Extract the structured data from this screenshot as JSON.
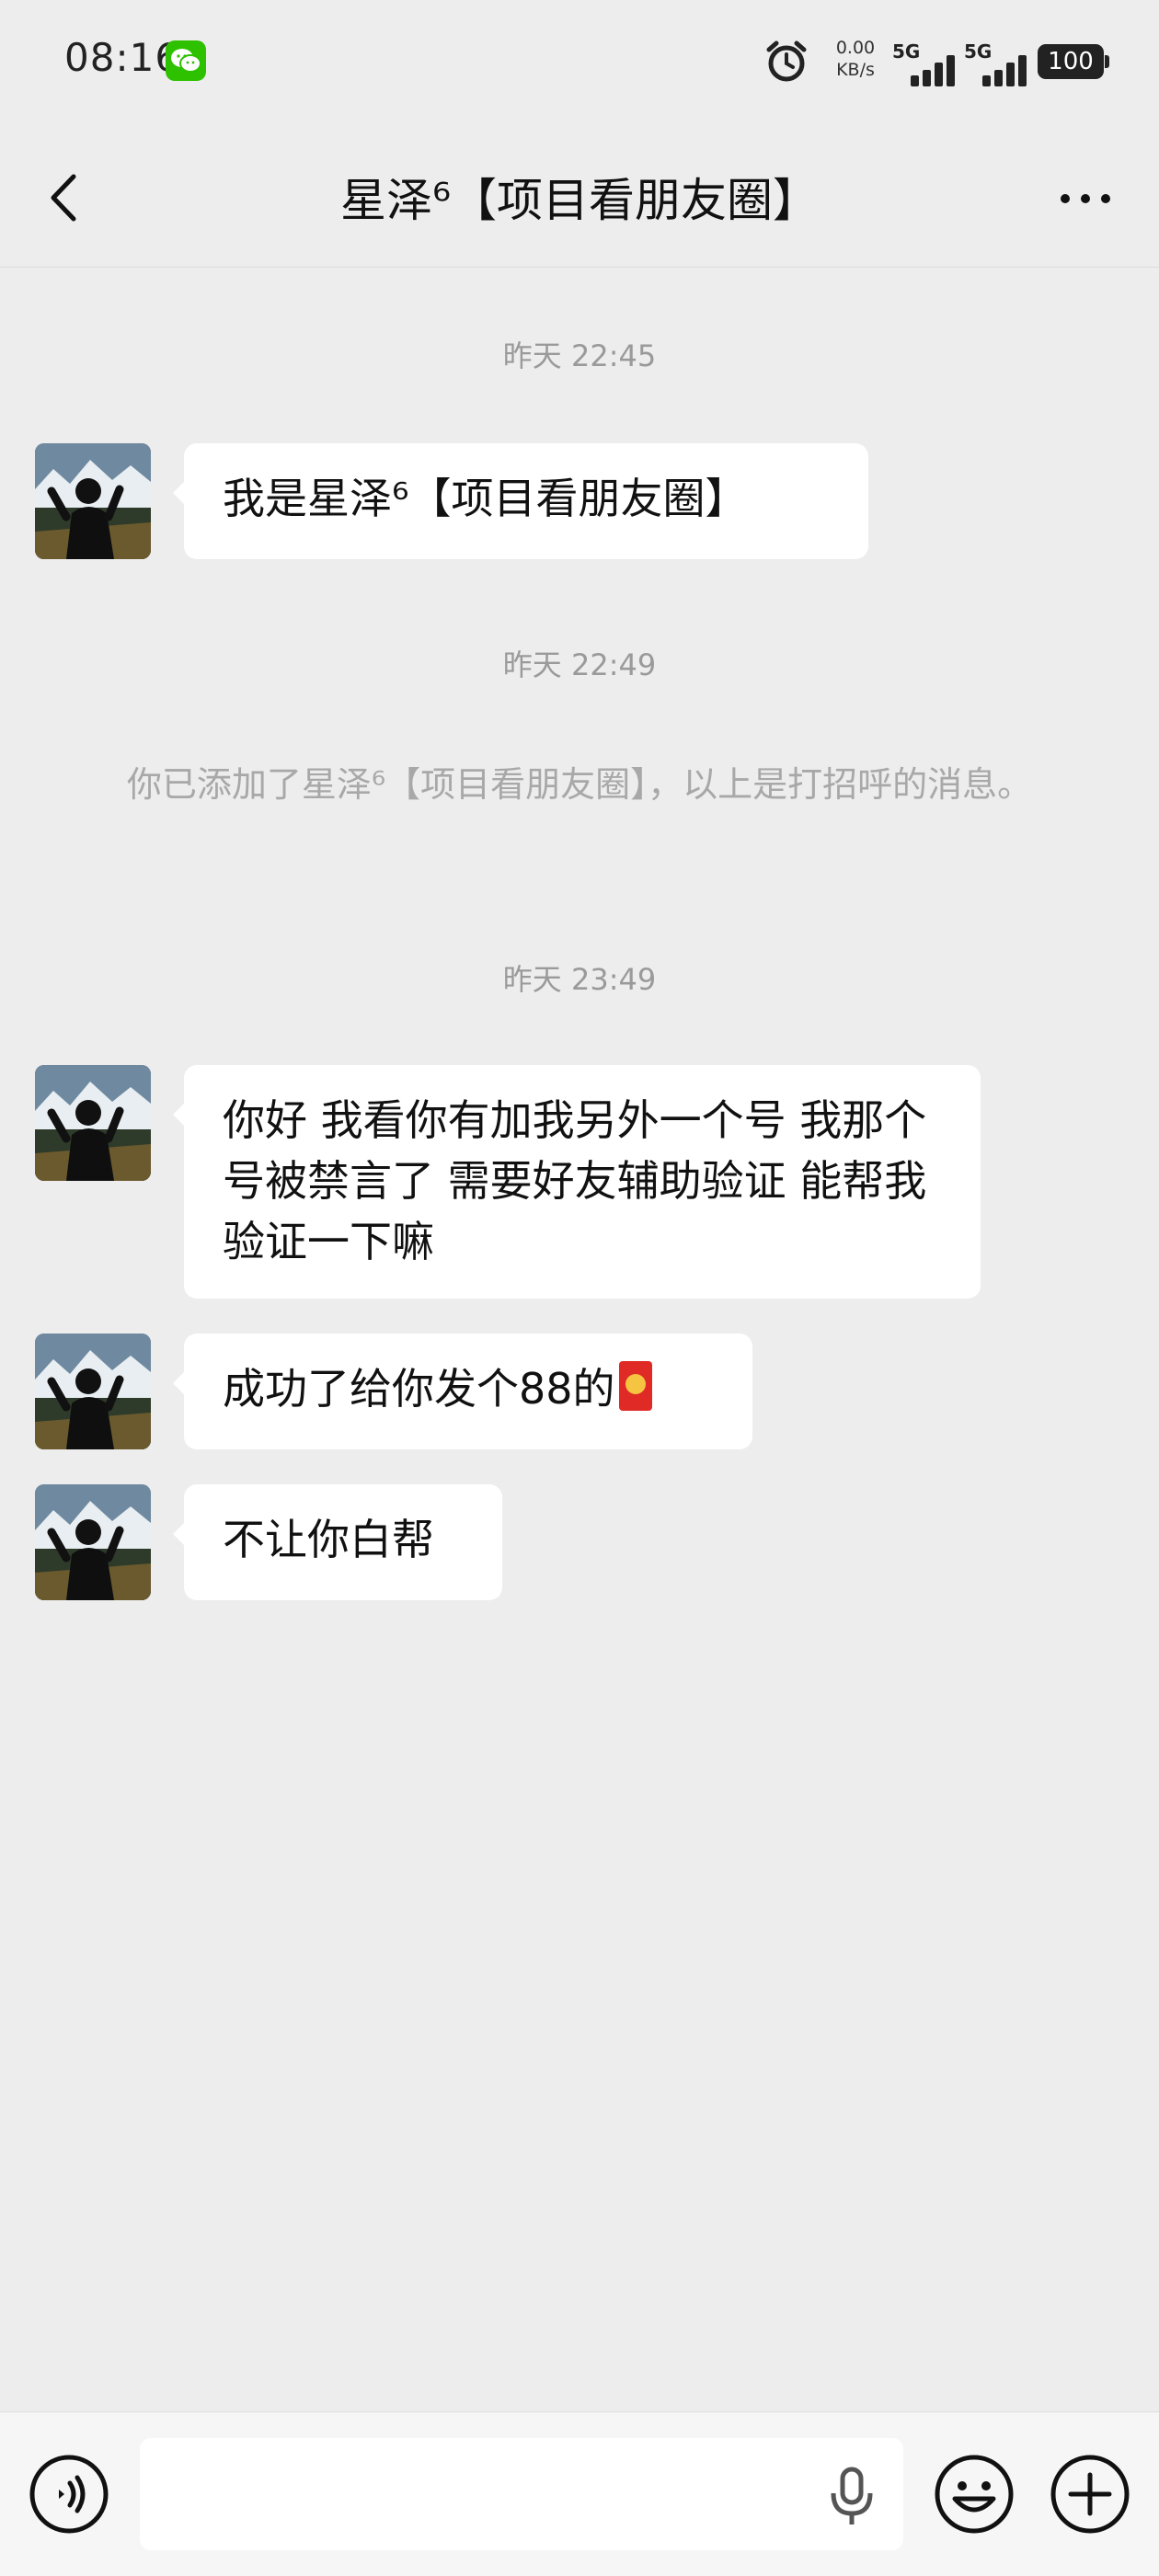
{
  "status_bar": {
    "time": "08:16",
    "net_speed_value": "0.00",
    "net_speed_unit": "KB/s",
    "sim1_label": "5G",
    "sim2_label": "5G",
    "battery": "100",
    "icons": [
      "wechat-notification-icon",
      "alarm-icon",
      "signal-icon",
      "battery-icon"
    ]
  },
  "navbar": {
    "title": "星泽⁶【项目看朋友圈】",
    "icons": [
      "back-arrow-icon",
      "more-dots-icon"
    ]
  },
  "chat": {
    "timestamp_1": "昨天 22:45",
    "message_1": "我是星泽⁶【项目看朋友圈】",
    "timestamp_2": "昨天 22:49",
    "system_message": "你已添加了星泽⁶【项目看朋友圈】，以上是打招呼的消息。",
    "timestamp_3": "昨天 23:49",
    "message_2": "你好 我看你有加我另外一个号 我那个号被禁言了 需要好友辅助验证 能帮我验证一下嘛",
    "message_3": "成功了给你发个88的",
    "message_4": "不让你白帮"
  },
  "input_bar": {
    "text_value": "",
    "icons": [
      "voice-icon",
      "microphone-icon",
      "emoji-icon",
      "plus-icon"
    ]
  },
  "colors": {
    "background": "#ededed",
    "bubble": "#ffffff",
    "wechat_green": "#2dc100",
    "red_packet": "#e02a25"
  }
}
